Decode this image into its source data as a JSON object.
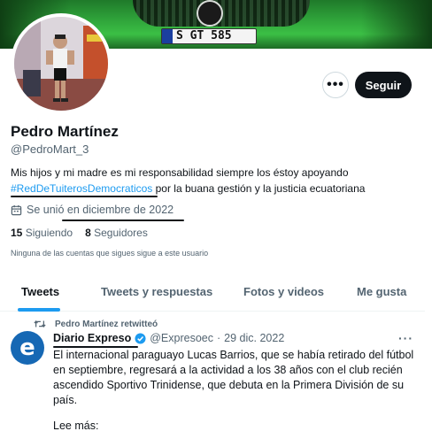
{
  "banner": {
    "plate_text": "S GT 585"
  },
  "profile": {
    "name": "Pedro Martínez",
    "handle": "@PedroMart_3",
    "bio_text_before": "Mis hijos y mi madre es mi responsabilidad siempre los éstoy apoyando",
    "bio_hashtag": "#RedDeTuiterosDemocraticos",
    "bio_text_after": " por la buana gestión y la justicia ecuatoriana",
    "joined_prefix": "Se unió en ",
    "joined_date": "diciembre de 2022",
    "following_count": "15",
    "following_label": "Siguiendo",
    "followers_count": "8",
    "followers_label": "Seguidores",
    "no_mutuals": "Ninguna de las cuentas que sigues sigue a este usuario"
  },
  "actions": {
    "more_label": "•••",
    "follow_label": "Seguir"
  },
  "tabs": [
    {
      "label": "Tweets"
    },
    {
      "label": "Tweets y respuestas"
    },
    {
      "label": "Fotos y videos"
    },
    {
      "label": "Me gusta"
    }
  ],
  "tweet": {
    "retweet_label": "Pedro Martínez retwitteó",
    "avatar_letter": "e",
    "author_name": "Diario Expreso",
    "author_handle": "@Expresoec",
    "separator": "·",
    "date": "29 dic. 2022",
    "more_label": "···",
    "text": "El internacional paraguayo Lucas Barrios, que se había retirado del fútbol en septiembre, regresará a la actividad a los 38 años con el club recién ascendido Sportivo Trinidense, que debuta en la Primera División de su país.",
    "read_more": "Lee más:"
  },
  "colors": {
    "accent": "#1d9bf0",
    "text": "#0f1419",
    "secondary": "#536471",
    "expreso_blue": "#1668b4"
  },
  "icons": [
    "more-icon",
    "calendar-icon",
    "retweet-icon",
    "verified-icon"
  ]
}
